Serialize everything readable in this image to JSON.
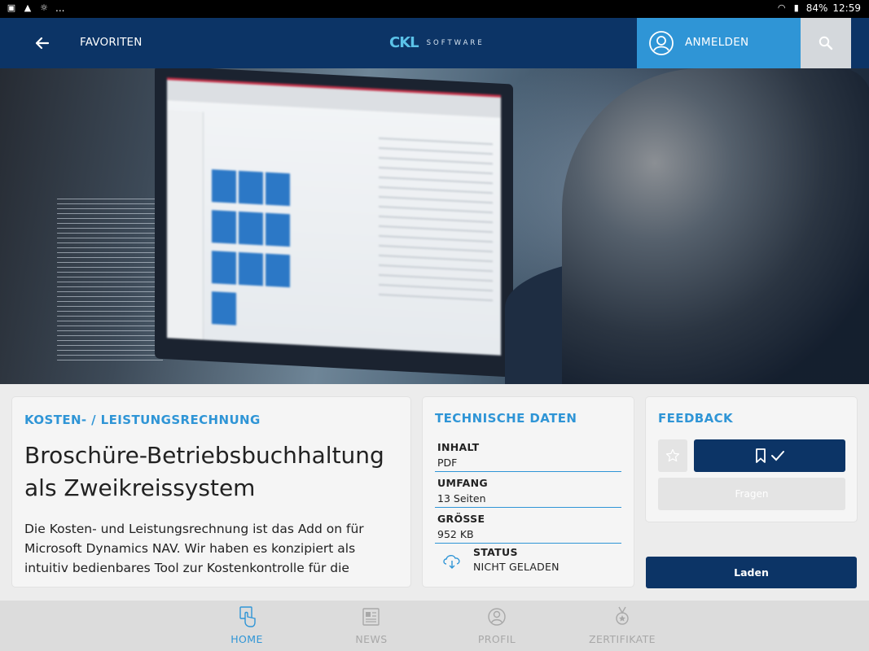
{
  "status_bar": {
    "battery": "84%",
    "time": "12:59",
    "more": "..."
  },
  "appbar": {
    "favorites_label": "FAVORITEN",
    "logo_mark": "CKL",
    "logo_text": "SOFTWARE",
    "login_label": "ANMELDEN"
  },
  "main_card": {
    "category": "KOSTEN- / LEISTUNGSRECHNUNG",
    "title": "Broschüre-Betriebsbuchhaltung als Zweikreissystem",
    "description": "Die Kosten- und Leistungsrechnung ist das Add on für Microsoft Dynamics NAV. Wir haben es konzipiert als intuitiv bedienbares Tool zur Kostenkontrolle für die"
  },
  "tech_card": {
    "heading": "TECHNISCHE DATEN",
    "rows": [
      {
        "key": "INHALT",
        "value": "PDF"
      },
      {
        "key": "UMFANG",
        "value": "13 Seiten"
      },
      {
        "key": "GRÖSSE",
        "value": "952 KB"
      }
    ],
    "status_key": "STATUS",
    "status_value": "NICHT GELADEN"
  },
  "feedback_card": {
    "heading": "FEEDBACK",
    "ask_label": "Fragen"
  },
  "load_button": "Laden",
  "bottom_nav": {
    "items": [
      {
        "label": "HOME",
        "icon": "touch-hand-icon",
        "active": true
      },
      {
        "label": "NEWS",
        "icon": "newspaper-icon",
        "active": false
      },
      {
        "label": "PROFIL",
        "icon": "profile-icon",
        "active": false
      },
      {
        "label": "ZERTIFIKATE",
        "icon": "medal-icon",
        "active": false
      }
    ]
  },
  "colors": {
    "primary_dark": "#0c3466",
    "accent_blue": "#2f95d6",
    "inactive_gray": "#a8a8a8"
  }
}
